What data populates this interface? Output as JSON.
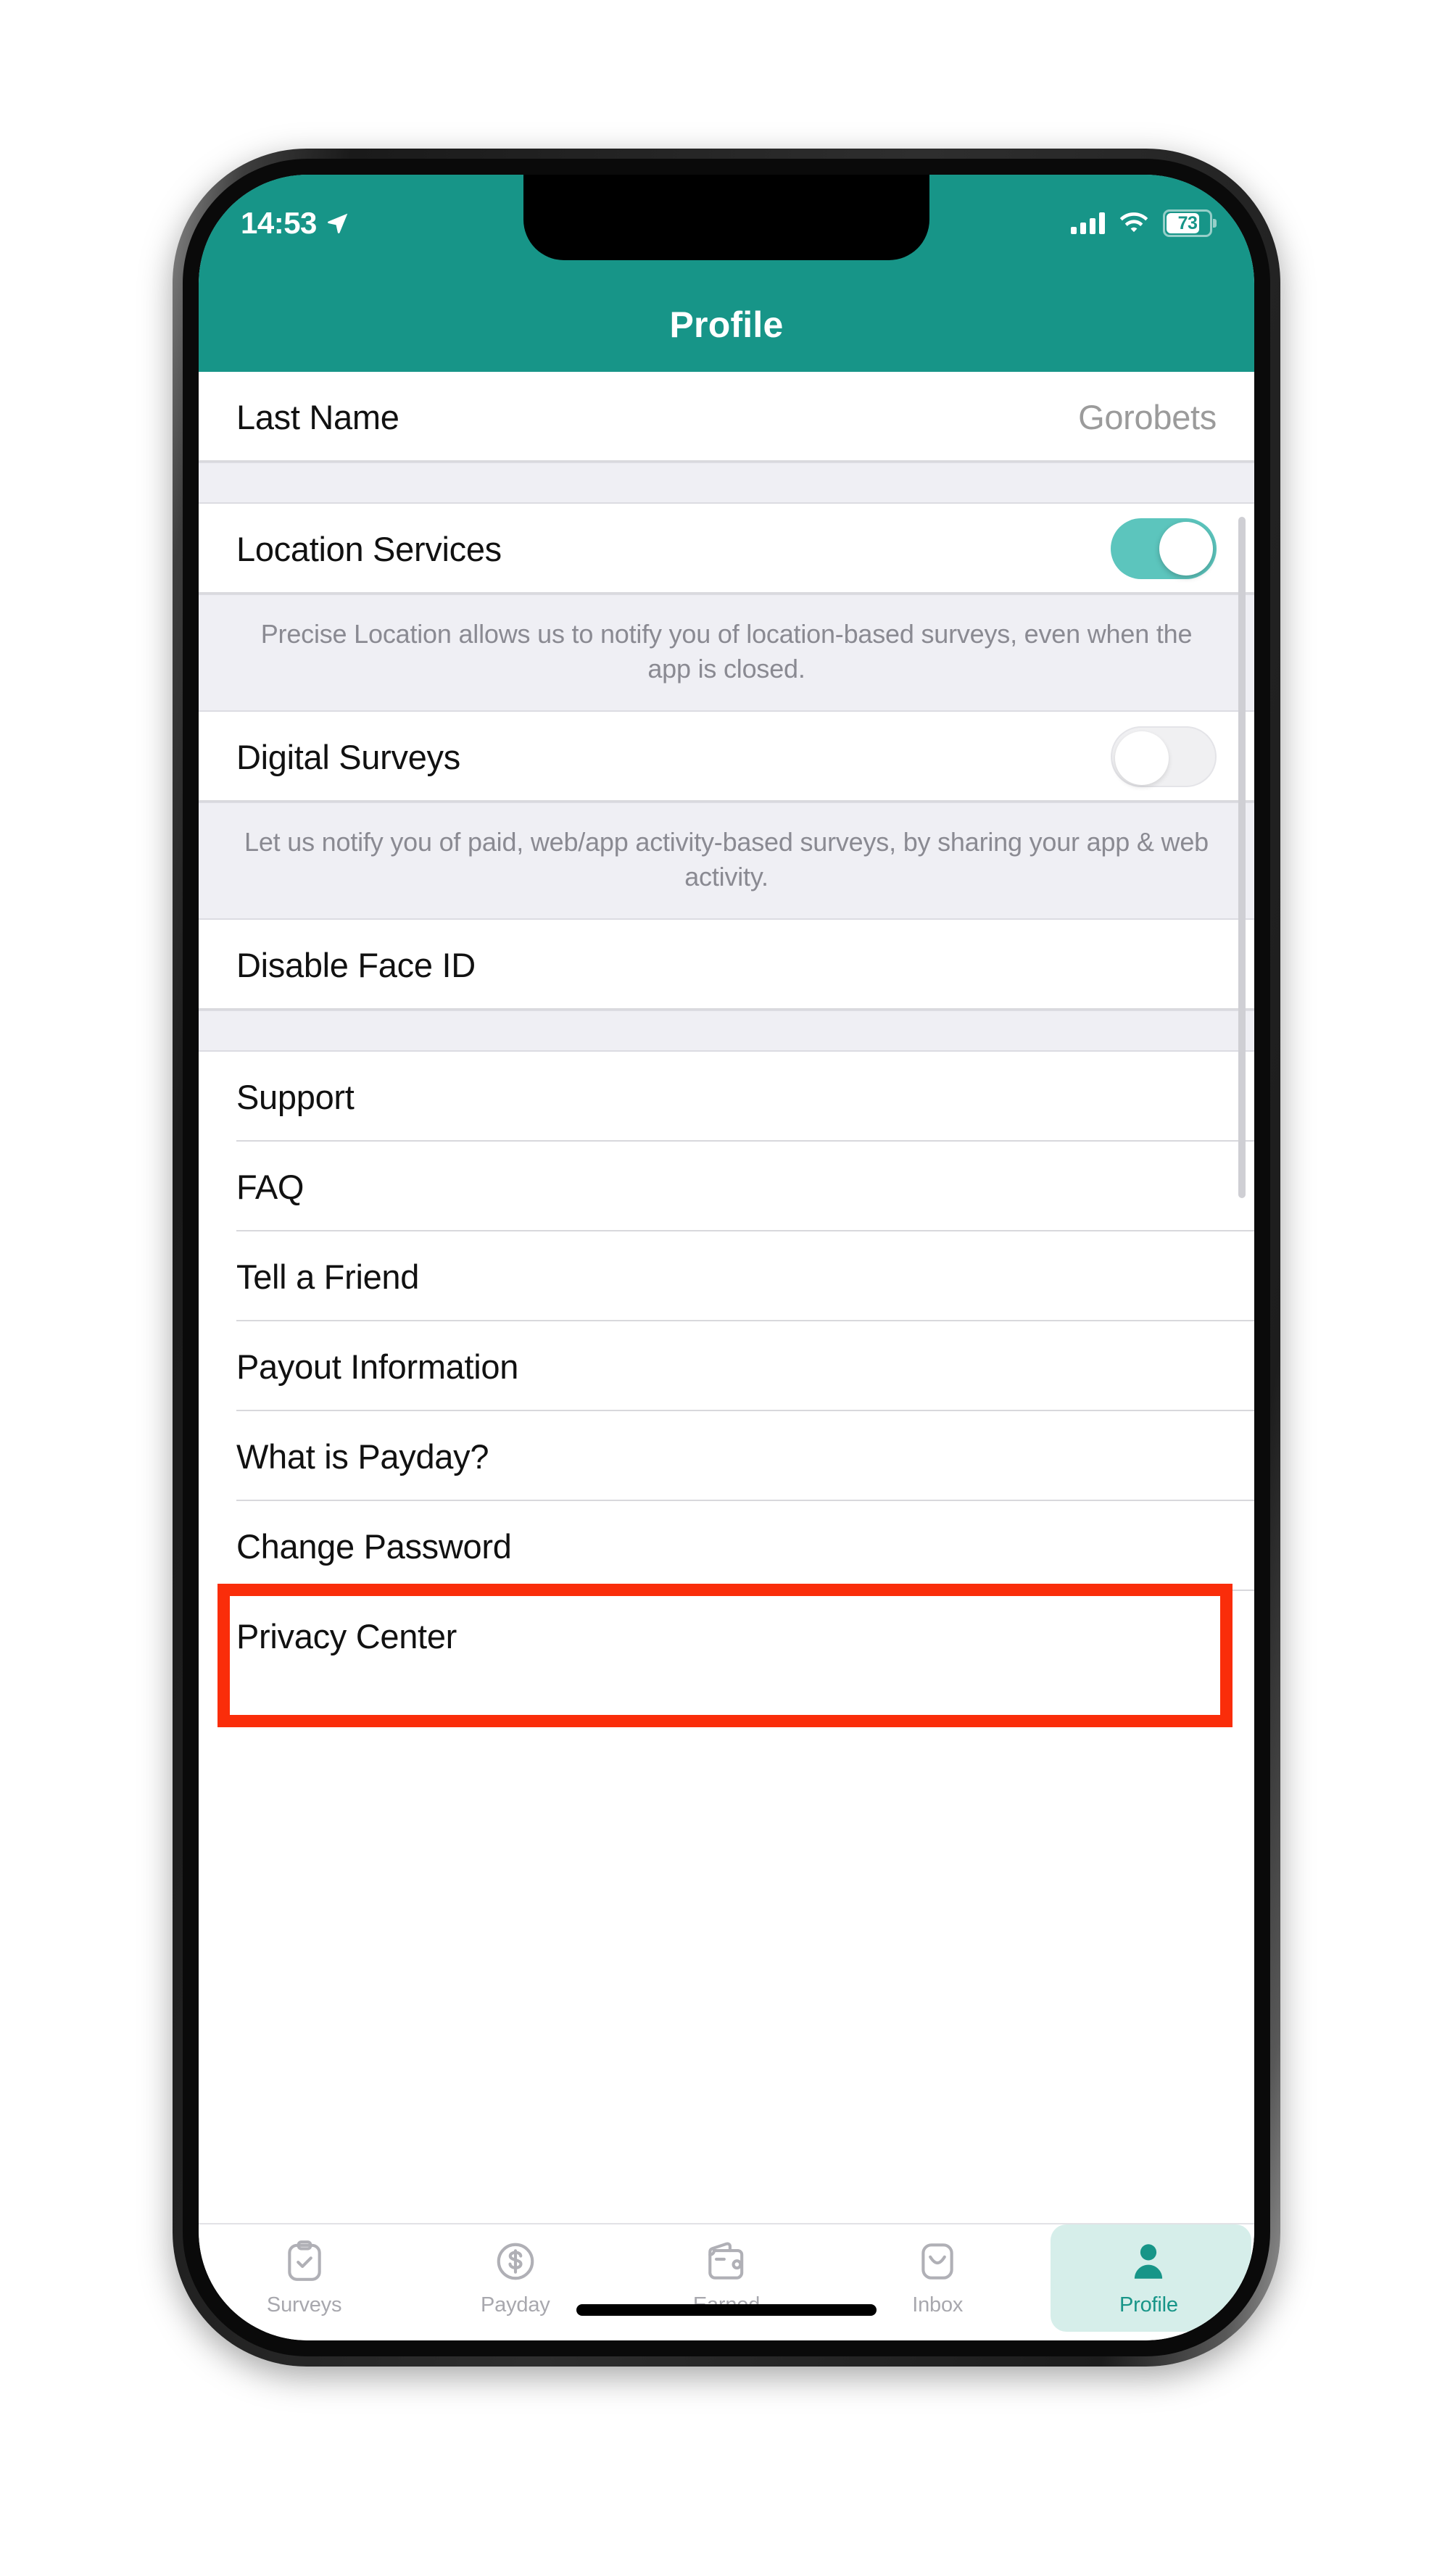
{
  "colors": {
    "brand_teal": "#179588",
    "toggle_on": "#5CC5BD",
    "section_bg": "#EFEFF4",
    "annotation_red": "#FA2D0A",
    "tab_active_pill": "#D6EEEA"
  },
  "status_bar": {
    "time": "14:53",
    "location_icon": "location-arrow-icon",
    "signal_icon": "cellular-signal-icon",
    "wifi_icon": "wifi-icon",
    "battery_level": "73"
  },
  "header": {
    "title": "Profile"
  },
  "list": {
    "rows": [
      {
        "type": "value",
        "label": "Last Name",
        "value": "Gorobets"
      },
      {
        "type": "gap"
      },
      {
        "type": "toggle",
        "label": "Location Services",
        "state": "on"
      },
      {
        "type": "footnote",
        "text": "Precise Location allows us to notify you of location-based surveys, even when the app is closed."
      },
      {
        "type": "toggle",
        "label": "Digital Surveys",
        "state": "off"
      },
      {
        "type": "footnote",
        "text": "Let us notify you of paid, web/app activity-based surveys, by sharing your app & web activity."
      },
      {
        "type": "link",
        "label": "Disable Face ID"
      },
      {
        "type": "gap"
      },
      {
        "type": "link",
        "label": "Support"
      },
      {
        "type": "link",
        "label": "FAQ"
      },
      {
        "type": "link",
        "label": "Tell a Friend",
        "highlighted": true
      },
      {
        "type": "link",
        "label": "Payout Information"
      },
      {
        "type": "link",
        "label": "What is Payday?"
      },
      {
        "type": "link",
        "label": "Change Password"
      },
      {
        "type": "link",
        "label": "Privacy Center"
      }
    ]
  },
  "tabs": [
    {
      "label": "Surveys",
      "icon": "clipboard-check-icon",
      "active": false
    },
    {
      "label": "Payday",
      "icon": "dollar-circle-icon",
      "active": false
    },
    {
      "label": "Earned",
      "icon": "wallet-icon",
      "active": false
    },
    {
      "label": "Inbox",
      "icon": "envelope-icon",
      "active": false
    },
    {
      "label": "Profile",
      "icon": "person-icon",
      "active": true
    }
  ]
}
